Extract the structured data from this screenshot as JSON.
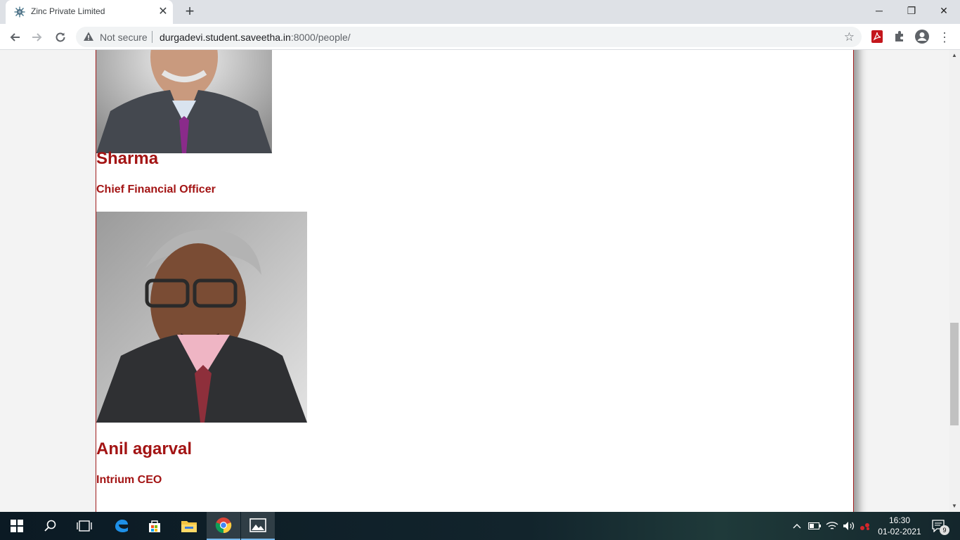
{
  "browser": {
    "tab_title": "Zinc Private Limited",
    "tab_close": "✕",
    "new_tab": "+",
    "window_buttons": {
      "minimize": "─",
      "restore": "❐",
      "close": "✕"
    },
    "not_secure_label": "Not secure",
    "url_host": "durgadevi.student.saveetha.in",
    "url_path": ":8000/people/"
  },
  "people": [
    {
      "name": "Sharma",
      "role": "Chief Financial Officer"
    },
    {
      "name": "Anil agarval",
      "role": "Intrium CEO"
    }
  ],
  "taskbar": {
    "time": "16:30",
    "date": "01-02-2021",
    "notification_count": "9"
  },
  "colors": {
    "heading": "#a31414",
    "page_border": "#a11d1d",
    "tab_strip": "#dee1e6"
  }
}
